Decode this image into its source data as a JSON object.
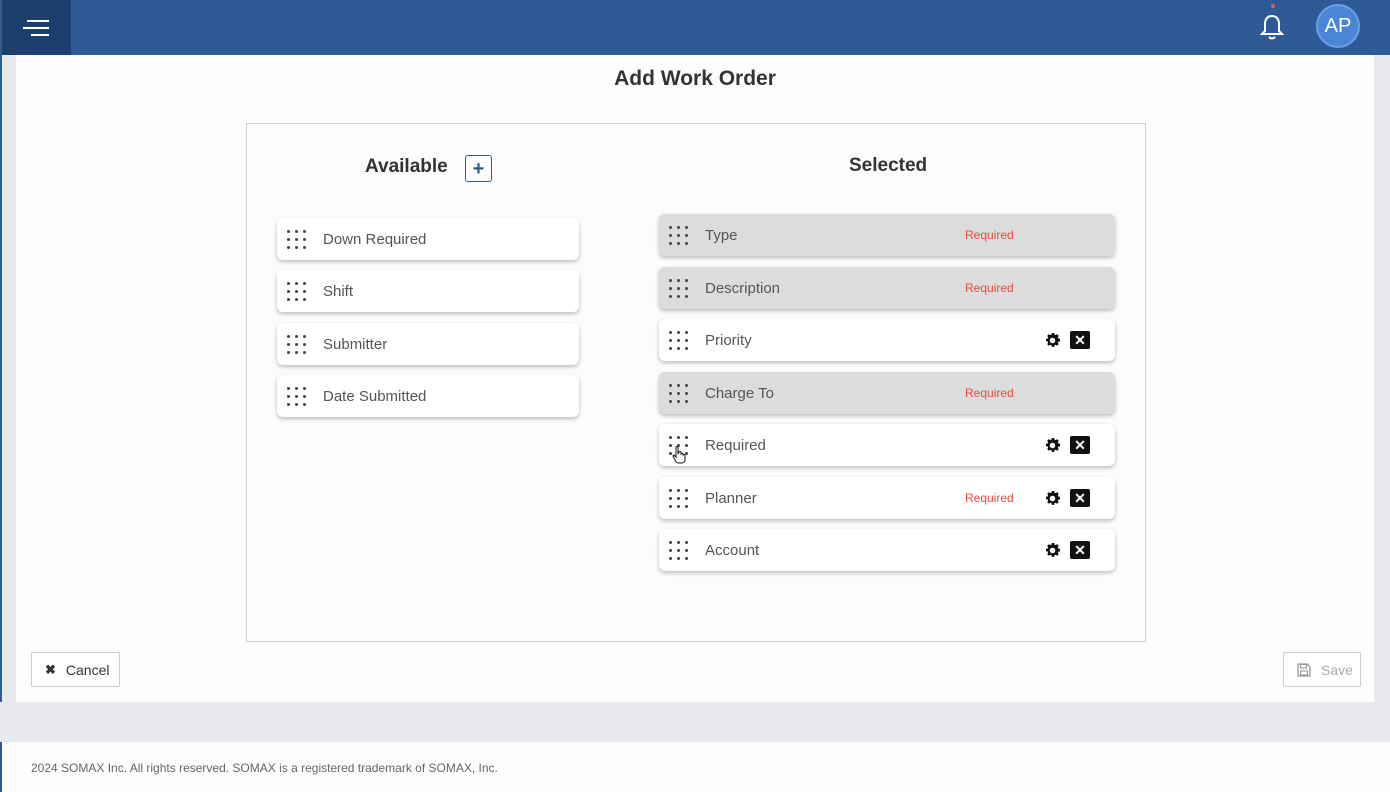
{
  "header": {
    "menu_icon": "hamburger-menu-icon",
    "bell_icon": "bell-icon",
    "avatar_initials": "AP",
    "brand_color": "#2e5b95"
  },
  "page": {
    "title": "Add Work Order"
  },
  "available": {
    "title": "Available",
    "add_icon": "plus-icon",
    "items": [
      {
        "label": "Down Required"
      },
      {
        "label": "Shift"
      },
      {
        "label": "Submitter"
      },
      {
        "label": "Date Submitted"
      }
    ]
  },
  "selected": {
    "title": "Selected",
    "items": [
      {
        "label": "Type",
        "required_text": "Required",
        "locked": true
      },
      {
        "label": "Description",
        "required_text": "Required",
        "locked": true
      },
      {
        "label": "Priority",
        "required_text": "",
        "locked": false
      },
      {
        "label": "Charge To",
        "required_text": "Required",
        "locked": true
      },
      {
        "label": "Required",
        "required_text": "",
        "locked": false
      },
      {
        "label": "Planner",
        "required_text": "Required",
        "locked": false
      },
      {
        "label": "Account",
        "required_text": "",
        "locked": false
      }
    ]
  },
  "actions": {
    "cancel_label": "Cancel",
    "save_label": "Save"
  },
  "footer": {
    "text": "2024 SOMAX Inc. All rights reserved. SOMAX is a registered trademark of SOMAX, Inc."
  },
  "colors": {
    "required": "#e74c3c",
    "locked_row": "#dcdcdc"
  }
}
